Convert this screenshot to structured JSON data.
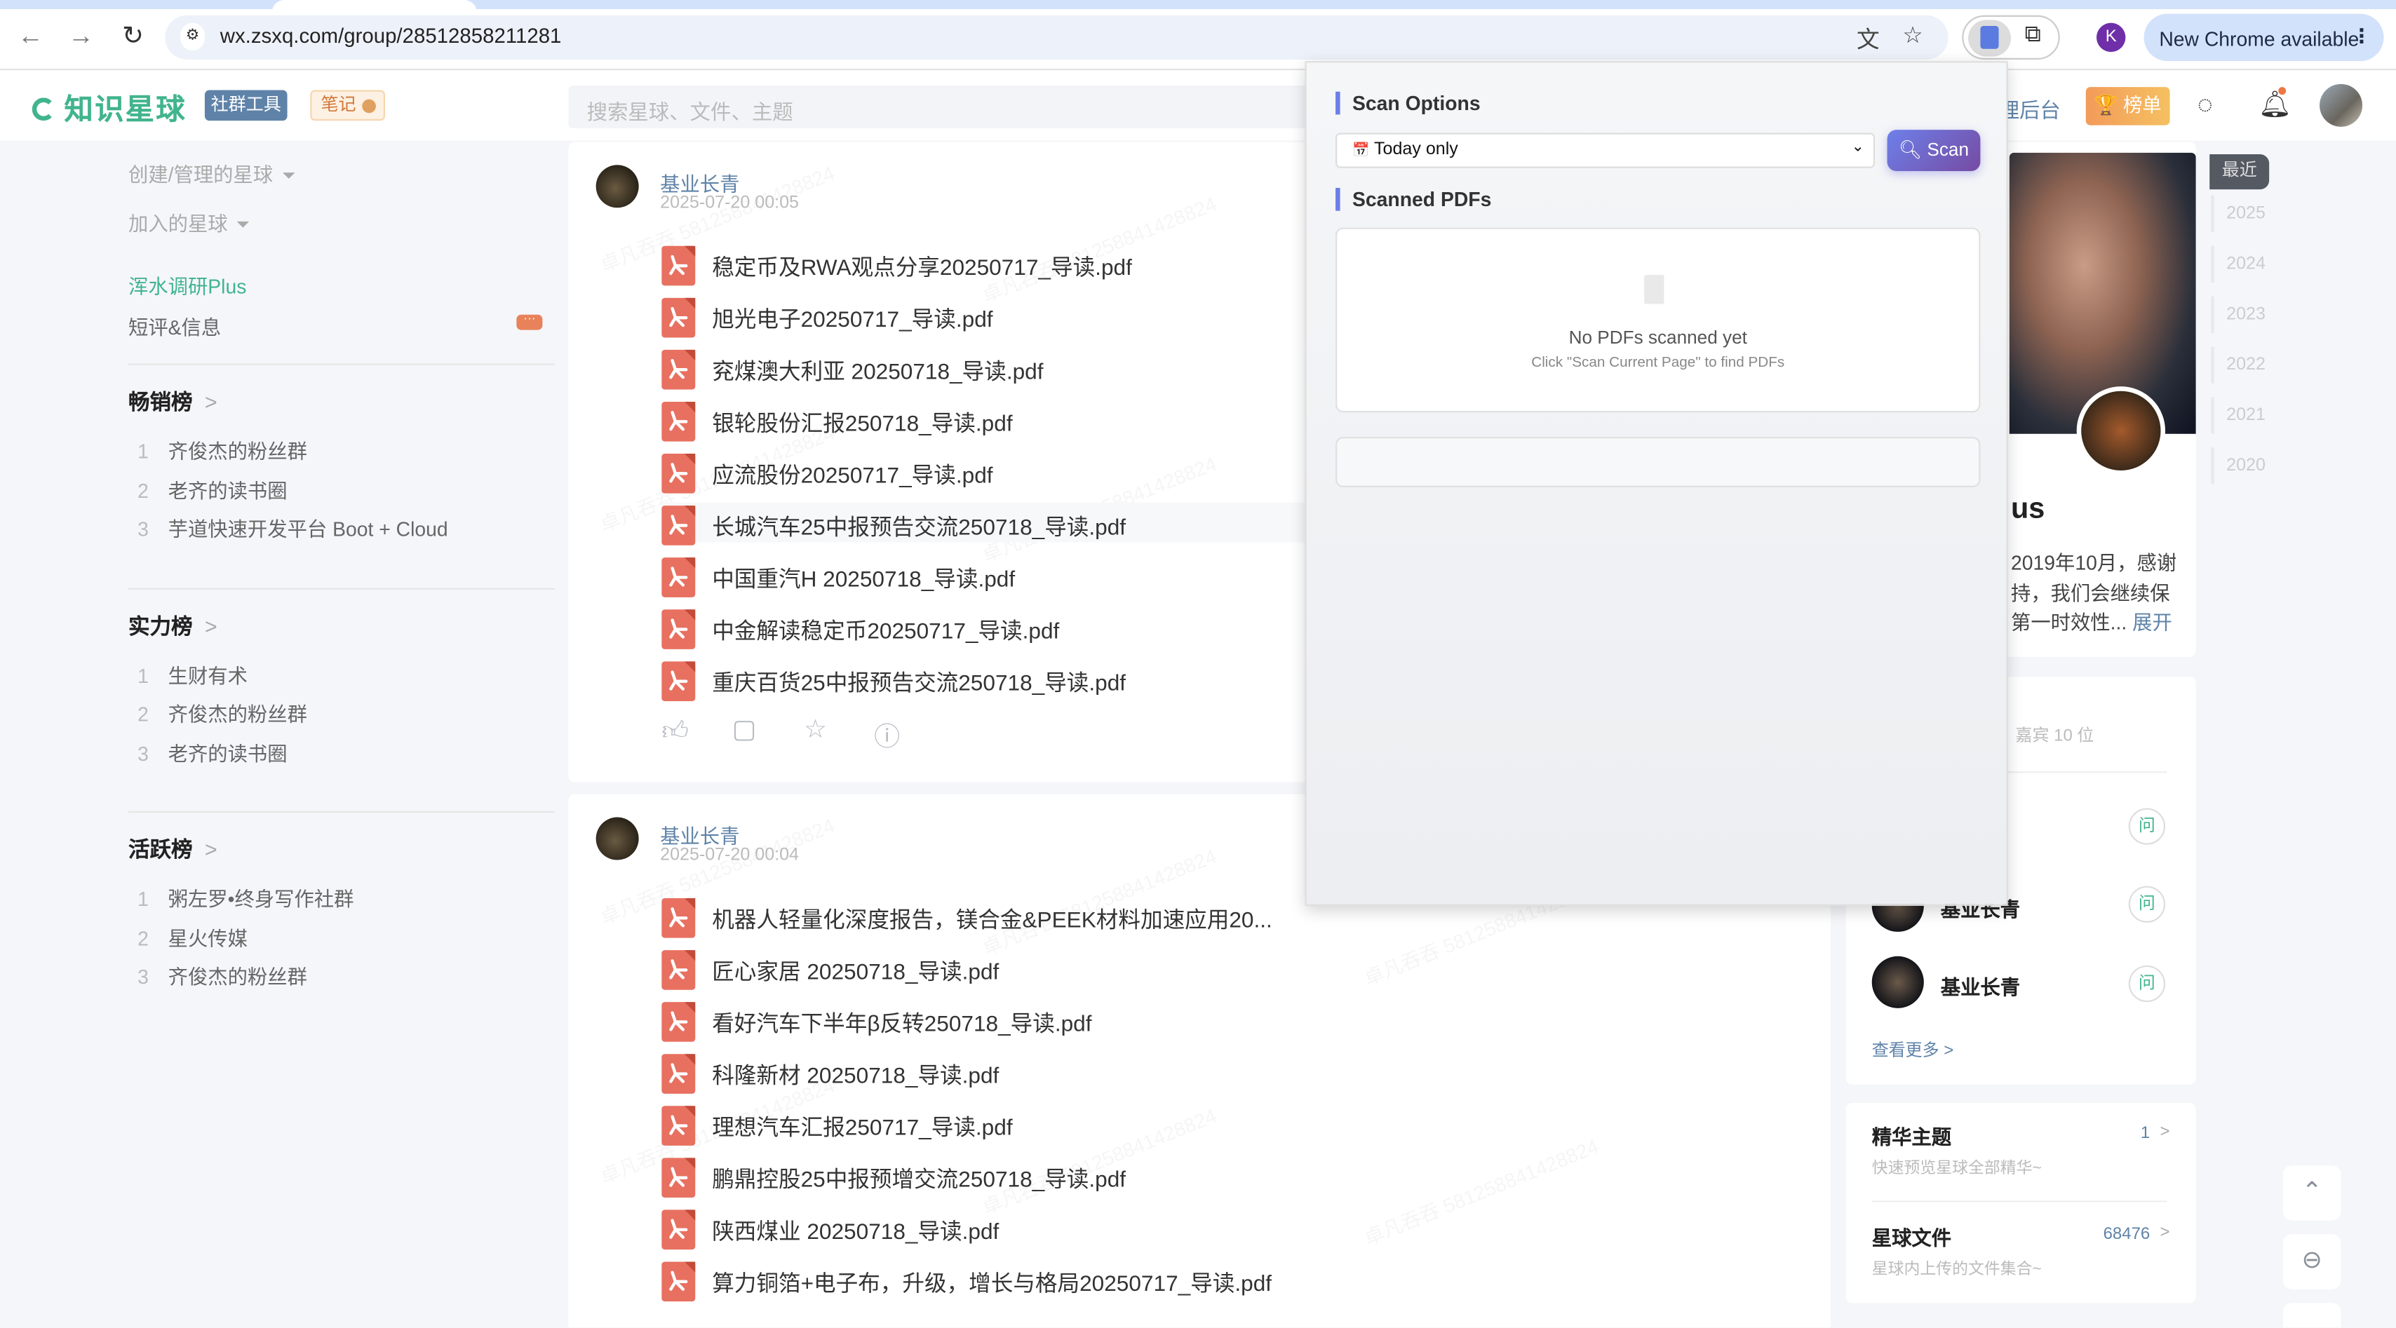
{
  "browser": {
    "url": "wx.zsxq.com/group/28512858211281",
    "profile_initial": "K",
    "new_chrome_label": "New Chrome available",
    "icons": [
      "back-icon",
      "forward-icon",
      "reload-icon",
      "site-settings-icon",
      "translate-icon",
      "star-icon",
      "pdf-extension-icon",
      "puzzle-icon",
      "menu-dots-icon"
    ]
  },
  "header": {
    "logo_text": "知识星球",
    "tools_badge": "社群工具",
    "note_badge": "笔记",
    "search_placeholder": "搜索星球、文件、主题",
    "admin_link": "理后台",
    "rank_button": "榜单",
    "brand_color": "#41b48e"
  },
  "sidebar": {
    "created": "创建/管理的星球",
    "joined": "加入的星球",
    "active_group": "浑水调研Plus",
    "short_reviews": "短评&信息",
    "sections": [
      {
        "title": "畅销榜",
        "items": [
          "齐俊杰的粉丝群",
          "老齐的读书圈",
          "芋道快速开发平台 Boot + Cloud"
        ]
      },
      {
        "title": "实力榜",
        "items": [
          "生财有术",
          "齐俊杰的粉丝群",
          "老齐的读书圈"
        ]
      },
      {
        "title": "活跃榜",
        "items": [
          "粥左罗•终身写作社群",
          "星火传媒",
          "齐俊杰的粉丝群"
        ]
      }
    ]
  },
  "watermark": "卓凡吞吞 581258841428824",
  "posts": [
    {
      "author": "基业长青",
      "time": "2025-07-20 00:05",
      "files": [
        "稳定币及RWA观点分享20250717_导读.pdf",
        "旭光电子20250717_导读.pdf",
        "兖煤澳大利亚 20250718_导读.pdf",
        "银轮股份汇报250718_导读.pdf",
        "应流股份20250717_导读.pdf",
        "长城汽车25中报预告交流250718_导读.pdf",
        "中国重汽H 20250718_导读.pdf",
        "中金解读稳定币20250717_导读.pdf",
        "重庆百货25中报预告交流250718_导读.pdf"
      ]
    },
    {
      "author": "基业长青",
      "time": "2025-07-20 00:04",
      "files": [
        "机器人轻量化深度报告，镁合金&PEEK材料加速应用20...",
        "匠心家居 20250718_导读.pdf",
        "看好汽车下半年β反转250718_导读.pdf",
        "科隆新材 20250718_导读.pdf",
        "理想汽车汇报250717_导读.pdf",
        "鹏鼎控股25中报预增交流250718_导读.pdf",
        "陕西煤业 20250718_导读.pdf",
        "算力铜箔+电子布，升级，增长与格局20250717_导读.pdf"
      ]
    }
  ],
  "popup": {
    "scan_options_title": "Scan Options",
    "range_selected": "Today only",
    "scan_button": "Scan",
    "scanned_title": "Scanned PDFs",
    "empty_title": "No PDFs scanned yet",
    "empty_hint": "Click \"Scan Current Page\" to find PDFs",
    "accent_color": "#6b7fe6"
  },
  "intro": {
    "title_fragment": "us",
    "lines": [
      "2019年10月，感谢",
      "持，我们会继续保",
      "第一时效性..."
    ],
    "expand": "展开"
  },
  "years": {
    "recent": "最近",
    "list": [
      "2025",
      "2024",
      "2023",
      "2022",
      "2021",
      "2020"
    ]
  },
  "members": {
    "guests": "，嘉宾 10 位",
    "ask_label": "问",
    "names": [
      "基业长青",
      "基业长青"
    ],
    "see_more": "查看更多 >"
  },
  "features": [
    {
      "title": "精华主题",
      "count": "1",
      "desc": "快速预览星球全部精华~"
    },
    {
      "title": "星球文件",
      "count": "68476",
      "desc": "星球内上传的文件集合~"
    }
  ]
}
